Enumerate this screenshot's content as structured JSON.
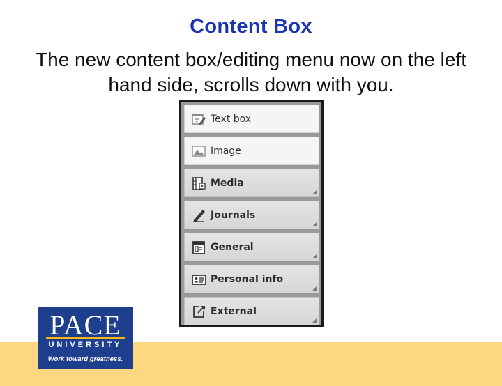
{
  "slide": {
    "title": "Content Box",
    "subtitle": "The new content box/editing menu now on the left hand side, scrolls down with you."
  },
  "menu": {
    "items": [
      {
        "label": "Text box",
        "icon": "text-box-icon",
        "style": "light"
      },
      {
        "label": "Image",
        "icon": "image-icon",
        "style": "light"
      },
      {
        "label": "Media",
        "icon": "media-icon",
        "style": "gray"
      },
      {
        "label": "Journals",
        "icon": "journals-icon",
        "style": "gray"
      },
      {
        "label": "General",
        "icon": "general-icon",
        "style": "gray"
      },
      {
        "label": "Personal info",
        "icon": "personal-info-icon",
        "style": "gray"
      },
      {
        "label": "External",
        "icon": "external-icon",
        "style": "gray"
      }
    ]
  },
  "logo": {
    "name": "PACE",
    "sub": "UNIVERSITY",
    "tagline": "Work toward greatness."
  },
  "colors": {
    "title": "#1a34b4",
    "footer_band": "#fdd880",
    "logo_bg": "#1e3f8e"
  }
}
